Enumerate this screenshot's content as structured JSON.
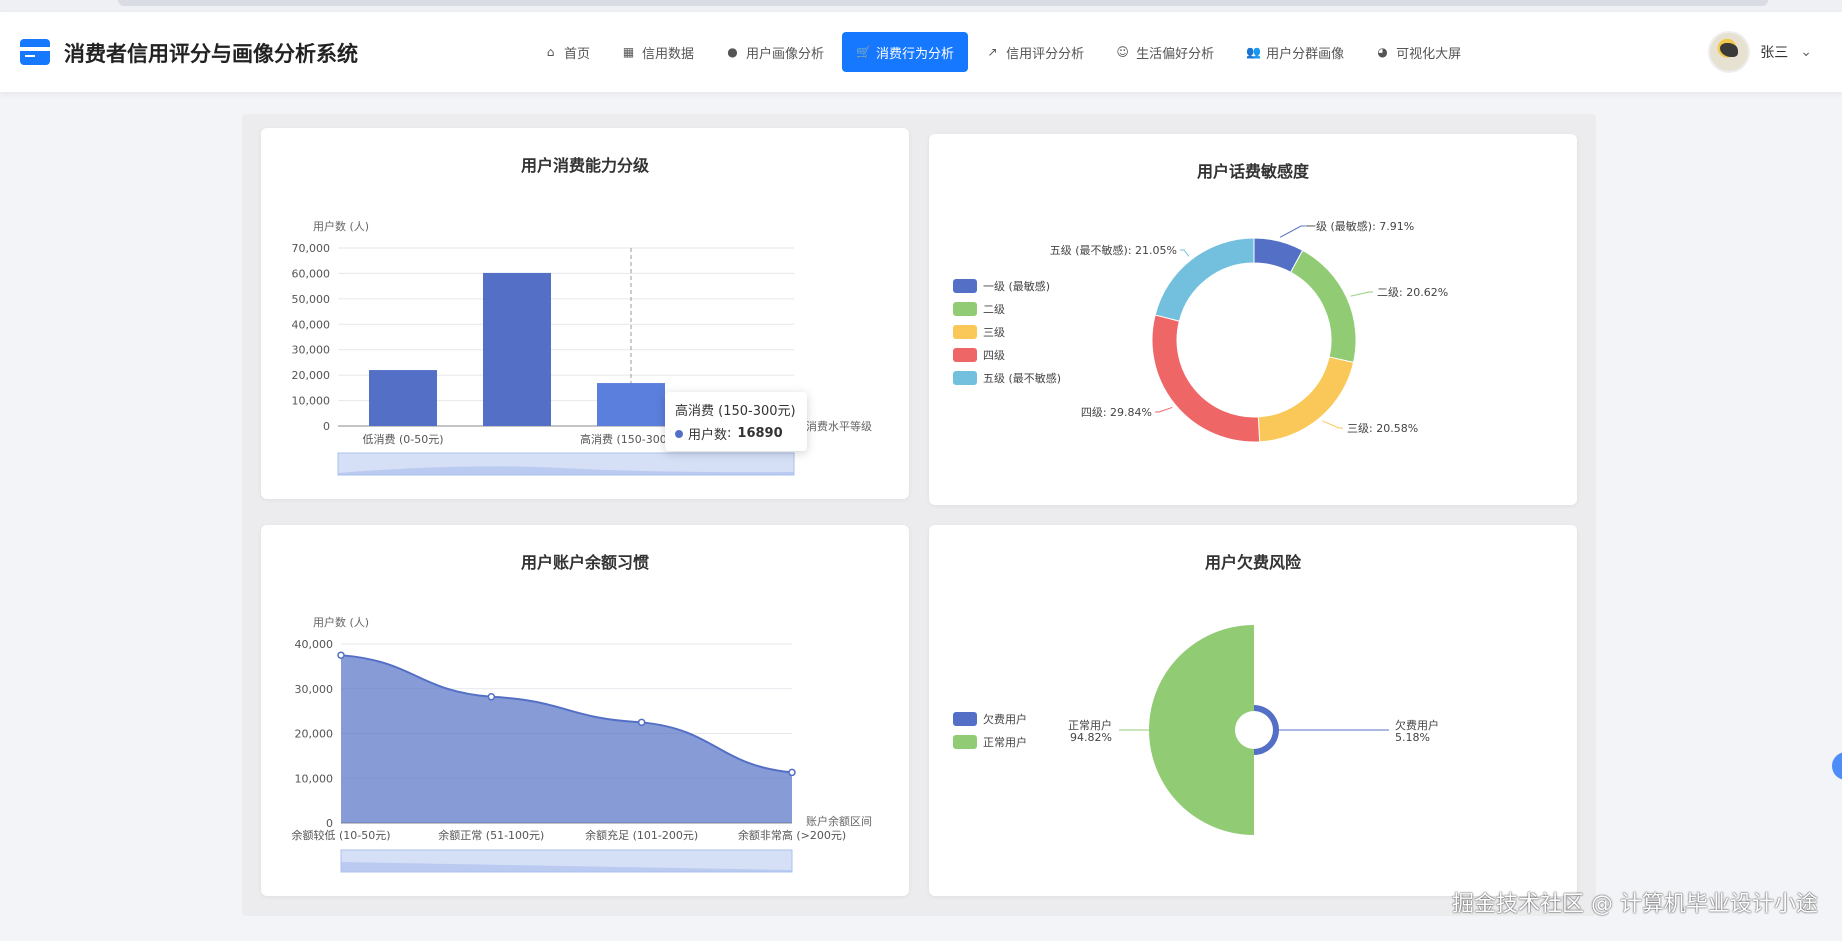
{
  "app": {
    "title": "消费者信用评分与画像分析系统"
  },
  "nav": [
    {
      "label": "首页",
      "icon": "home-icon",
      "glyph": "⌂"
    },
    {
      "label": "信用数据",
      "icon": "table-icon",
      "glyph": "▦"
    },
    {
      "label": "用户画像分析",
      "icon": "user-icon",
      "glyph": "●"
    },
    {
      "label": "消费行为分析",
      "icon": "cart-icon",
      "glyph": "🛒",
      "active": true
    },
    {
      "label": "信用评分分析",
      "icon": "line-chart-icon",
      "glyph": "↗"
    },
    {
      "label": "生活偏好分析",
      "icon": "smile-icon",
      "glyph": "☺"
    },
    {
      "label": "用户分群画像",
      "icon": "users-icon",
      "glyph": "👥"
    },
    {
      "label": "可视化大屏",
      "icon": "pie-chart-icon",
      "glyph": "◕"
    }
  ],
  "user": {
    "name": "张三"
  },
  "colors": {
    "accent": "#1677ff",
    "blue": "#5470c6",
    "green": "#91cc75",
    "yellow": "#fac858",
    "red": "#ee6666",
    "cyan": "#73c0de"
  },
  "watermark": "掘金技术社区 @ 计算机毕业设计小途",
  "chart_data": [
    {
      "id": "consumption",
      "type": "bar",
      "title": "用户消费能力分级",
      "ylabel": "用户数 (人)",
      "xlabel": "消费水平等级",
      "ylim": [
        0,
        70000
      ],
      "yticks": [
        "0",
        "10,000",
        "20,000",
        "30,000",
        "40,000",
        "50,000",
        "60,000",
        "70,000"
      ],
      "categories": [
        "低消费 (0-50元)",
        "",
        "高消费 (150-300元)"
      ],
      "values": [
        22000,
        60200,
        16890
      ],
      "tooltip": {
        "title": "高消费 (150-300元)",
        "series": "用户数",
        "value": "16890"
      }
    },
    {
      "id": "sensitivity",
      "type": "pie",
      "title": "用户话费敏感度",
      "legend": [
        "一级 (最敏感)",
        "二级",
        "三级",
        "四级",
        "五级 (最不敏感)"
      ],
      "values": [
        7.91,
        20.62,
        20.58,
        29.84,
        21.05
      ],
      "labels": [
        "一级 (最敏感): 7.91%",
        "二级: 20.62%",
        "三级: 20.58%",
        "四级: 29.84%",
        "五级 (最不敏感): 21.05%"
      ]
    },
    {
      "id": "balance",
      "type": "area",
      "title": "用户账户余额习惯",
      "ylabel": "用户数 (人)",
      "xlabel": "账户余额区间",
      "ylim": [
        0,
        40000
      ],
      "yticks": [
        "0",
        "10,000",
        "20,000",
        "30,000",
        "40,000"
      ],
      "categories": [
        "余额较低 (10-50元)",
        "余额正常 (51-100元)",
        "余额充足 (101-200元)",
        "余额非常高 (>200元)"
      ],
      "values": [
        37500,
        28200,
        22500,
        11300
      ]
    },
    {
      "id": "arrears",
      "type": "pie",
      "title": "用户欠费风险",
      "legend": [
        "欠费用户",
        "正常用户"
      ],
      "values": [
        5.18,
        94.82
      ],
      "labels": [
        [
          "欠费用户",
          "5.18%"
        ],
        [
          "正常用户",
          "94.82%"
        ]
      ]
    }
  ]
}
